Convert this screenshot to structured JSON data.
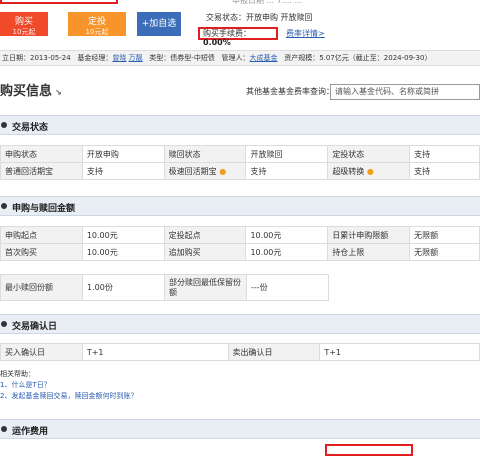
{
  "header": {
    "buy_button": {
      "label": "购买",
      "sub": "10元起"
    },
    "plan_button": {
      "label": "定投",
      "sub": "10元起"
    },
    "add_button": "+加自选",
    "trade_status": "交易状态：开放申购    开放赎回",
    "fee_label": "购买手续费：",
    "fee_value": "0.00%",
    "fee_detail_link": "费率详情>",
    "partial_top": "申报日期 ... 7.... ..."
  },
  "info_bar": {
    "established": "立日期：2013-05-24",
    "manager_label": "基金经理：",
    "managers": [
      "曾晓",
      "万靓"
    ],
    "type": "类型：债券型-中短债",
    "custodian_label": "管理人：",
    "custodian": "大成基金",
    "asset": "资产规模：5.07亿元（截止至：2024-09-30）"
  },
  "page_title": "购买信息",
  "search": {
    "label": "其他基金基金费率查询：",
    "placeholder": "请输入基金代码、名称或简拼"
  },
  "trade_status_section": {
    "title": "交易状态",
    "rows": [
      [
        "申购状态",
        "开放申购",
        "赎回状态",
        "开放赎回",
        "定投状态",
        "支持"
      ],
      [
        "普通回活期宝",
        "支持",
        "极速回活期宝",
        "支持",
        "超级转换",
        "支持"
      ]
    ]
  },
  "amount_section": {
    "title": "申购与赎回金额",
    "rows": [
      [
        "申购起点",
        "10.00元",
        "定投起点",
        "10.00元",
        "日累计申购限额",
        "无限额"
      ],
      [
        "首次购买",
        "10.00元",
        "追加购买",
        "10.00元",
        "持仓上限",
        "无限额"
      ]
    ],
    "redeem_row": [
      "最小赎回份额",
      "1.00份",
      "部分赎回最低保留份额",
      "---份"
    ]
  },
  "confirm_section": {
    "title": "交易确认日",
    "row": [
      "买入确认日",
      "T+1",
      "卖出确认日",
      "T+1"
    ],
    "help_title": "相关帮助：",
    "help_items": [
      "1、什么是T日？",
      "2、发起基金赎回交易，赎回金额何时到账？"
    ]
  },
  "ops_section": {
    "title": "运作费用"
  },
  "colors": {
    "buy": "#f04a2b",
    "plan": "#f7942c",
    "add": "#3b6db8",
    "highlight": "#e02020",
    "link": "#2a5db0"
  }
}
